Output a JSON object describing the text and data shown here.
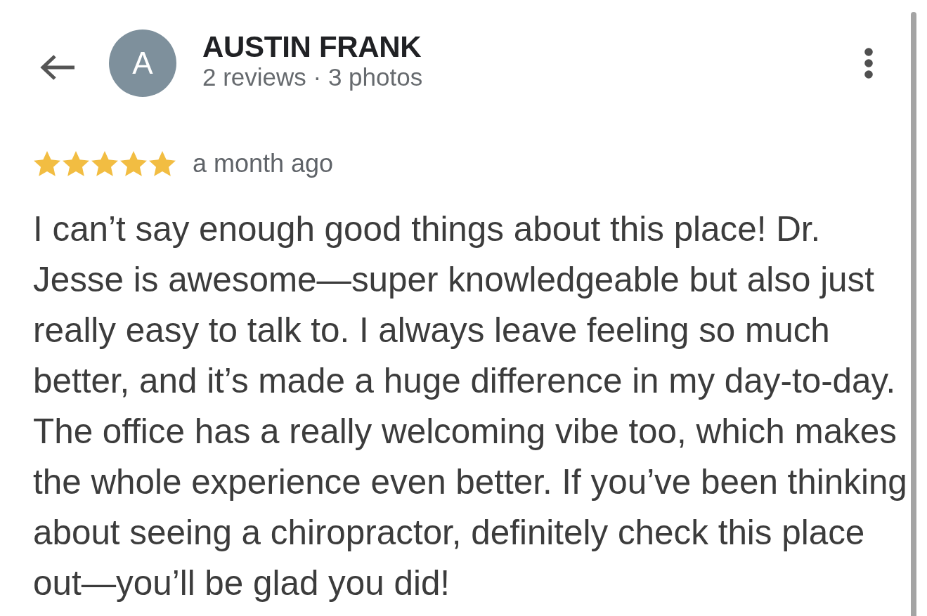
{
  "reviewer": {
    "avatar_letter": "A",
    "name": "AUSTIN FRANK",
    "stats": "2 reviews · 3 photos"
  },
  "review": {
    "stars": 5,
    "time": "a month ago",
    "text": "I can’t say enough good things about this place! Dr. Jesse is awesome—super knowledgeable but also just really easy to talk to. I always leave feeling so much better, and it’s made a huge difference in my day-to-day. The office has a really welcoming vibe too, which makes the whole experience even better. If you’ve been thinking about seeing a chiropractor, definitely check this place out—you’ll be glad you did!"
  }
}
